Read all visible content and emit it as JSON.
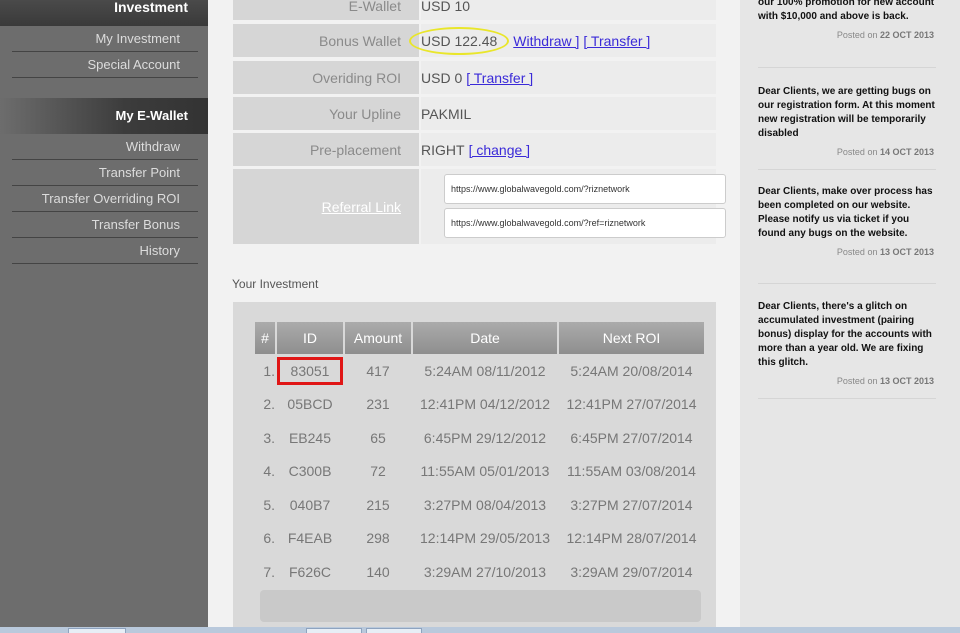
{
  "sidebar": {
    "header": "Investment",
    "investment_items": [
      "My Investment",
      "Special Account"
    ],
    "ewallet_title": "My E-Wallet",
    "ewallet_items": [
      "Withdraw",
      "Transfer Point",
      "Transfer Overriding ROI",
      "Transfer Bonus",
      "History"
    ]
  },
  "wallet": {
    "ewallet_label": "E-Wallet",
    "ewallet_value": "USD 10",
    "bonus_label": "Bonus Wallet",
    "bonus_value": "USD 122.48",
    "withdraw_link": "Withdraw ]",
    "transfer_link": "[ Transfer ]",
    "overiding_label": "Overiding ROI",
    "overiding_value": "USD 0",
    "overiding_transfer": "[ Transfer ]",
    "upline_label": "Your Upline",
    "upline_value": "PAKMIL",
    "preplacement_label": "Pre-placement",
    "preplacement_value": "RIGHT",
    "change_link": "[ change ]",
    "referral_label": "Referral Link",
    "referral_url_1": "https://www.globalwavegold.com/?riznetwork",
    "referral_url_2": "https://www.globalwavegold.com/?ref=riznetwork"
  },
  "investment": {
    "title": "Your Investment",
    "columns": [
      "#",
      "ID",
      "Amount",
      "Date",
      "Next ROI"
    ],
    "rows": [
      {
        "n": "1.",
        "id": "83051",
        "amount": "417",
        "date": "5:24AM 08/11/2012",
        "next": "5:24AM 20/08/2014"
      },
      {
        "n": "2.",
        "id": "05BCD",
        "amount": "231",
        "date": "12:41PM 04/12/2012",
        "next": "12:41PM 27/07/2014"
      },
      {
        "n": "3.",
        "id": "EB245",
        "amount": "65",
        "date": "6:45PM 29/12/2012",
        "next": "6:45PM 27/07/2014"
      },
      {
        "n": "4.",
        "id": "C300B",
        "amount": "72",
        "date": "11:55AM 05/01/2013",
        "next": "11:55AM 03/08/2014"
      },
      {
        "n": "5.",
        "id": "040B7",
        "amount": "215",
        "date": "3:27PM 08/04/2013",
        "next": "3:27PM 27/07/2014"
      },
      {
        "n": "6.",
        "id": "F4EAB",
        "amount": "298",
        "date": "12:14PM 29/05/2013",
        "next": "12:14PM 28/07/2014"
      },
      {
        "n": "7.",
        "id": "F626C",
        "amount": "140",
        "date": "3:29AM 27/10/2013",
        "next": "3:29AM 29/07/2014"
      }
    ]
  },
  "news": [
    {
      "text": "our 100% promotion for new account with $10,000 and above is back.",
      "posted": "Posted on",
      "date": "22 OCT 2013"
    },
    {
      "text": "Dear Clients, we are getting bugs on our registration form. At this moment new registration will be temporarily disabled",
      "posted": "Posted on",
      "date": "14 OCT 2013"
    },
    {
      "text": "Dear Clients, make over process has been completed on our website. Please notify us via ticket if you found any bugs on the website.",
      "posted": "Posted on",
      "date": "13 OCT 2013"
    },
    {
      "text": "Dear Clients, there's a glitch on accumulated investment (pairing bonus) display for the accounts with more than a year old. We are fixing this glitch.",
      "posted": "Posted on",
      "date": "13 OCT 2013"
    }
  ],
  "colors": {
    "sidebar_bg": "#6d6d6d",
    "link": "#3a2ad8",
    "highlight_circle": "#e9e62a",
    "highlight_box": "#e01616"
  }
}
